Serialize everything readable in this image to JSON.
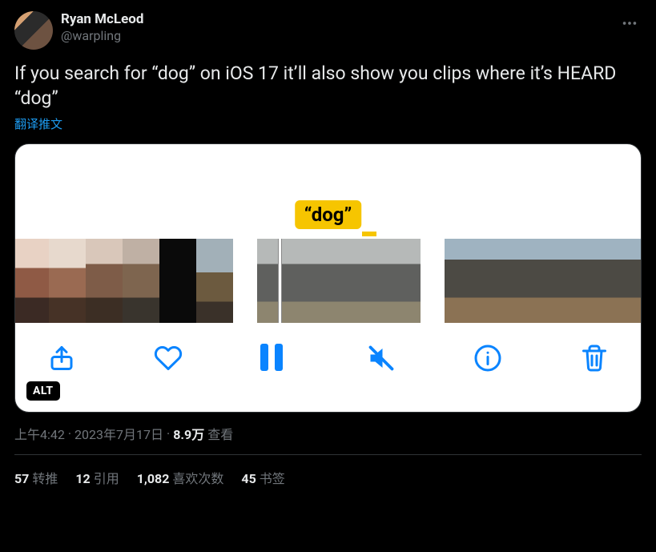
{
  "author": {
    "display_name": "Ryan McLeod",
    "handle": "@warpling"
  },
  "tweet_text": "If you search for “dog” on iOS 17 it’ll also show you clips where it’s HEARD “dog”",
  "translate_label": "翻译推文",
  "media": {
    "chip_label": "“dog”",
    "alt_badge": "ALT"
  },
  "meta": {
    "time": "上午4:42",
    "sep1": " · ",
    "date": "2023年7月17日",
    "sep2": " · ",
    "views_num": "8.9万",
    "views_label": " 查看"
  },
  "stats": {
    "retweets_num": "57",
    "retweets_label": "转推",
    "quotes_num": "12",
    "quotes_label": "引用",
    "likes_num": "1,082",
    "likes_label": "喜欢次数",
    "bookmarks_num": "45",
    "bookmarks_label": "书签"
  }
}
